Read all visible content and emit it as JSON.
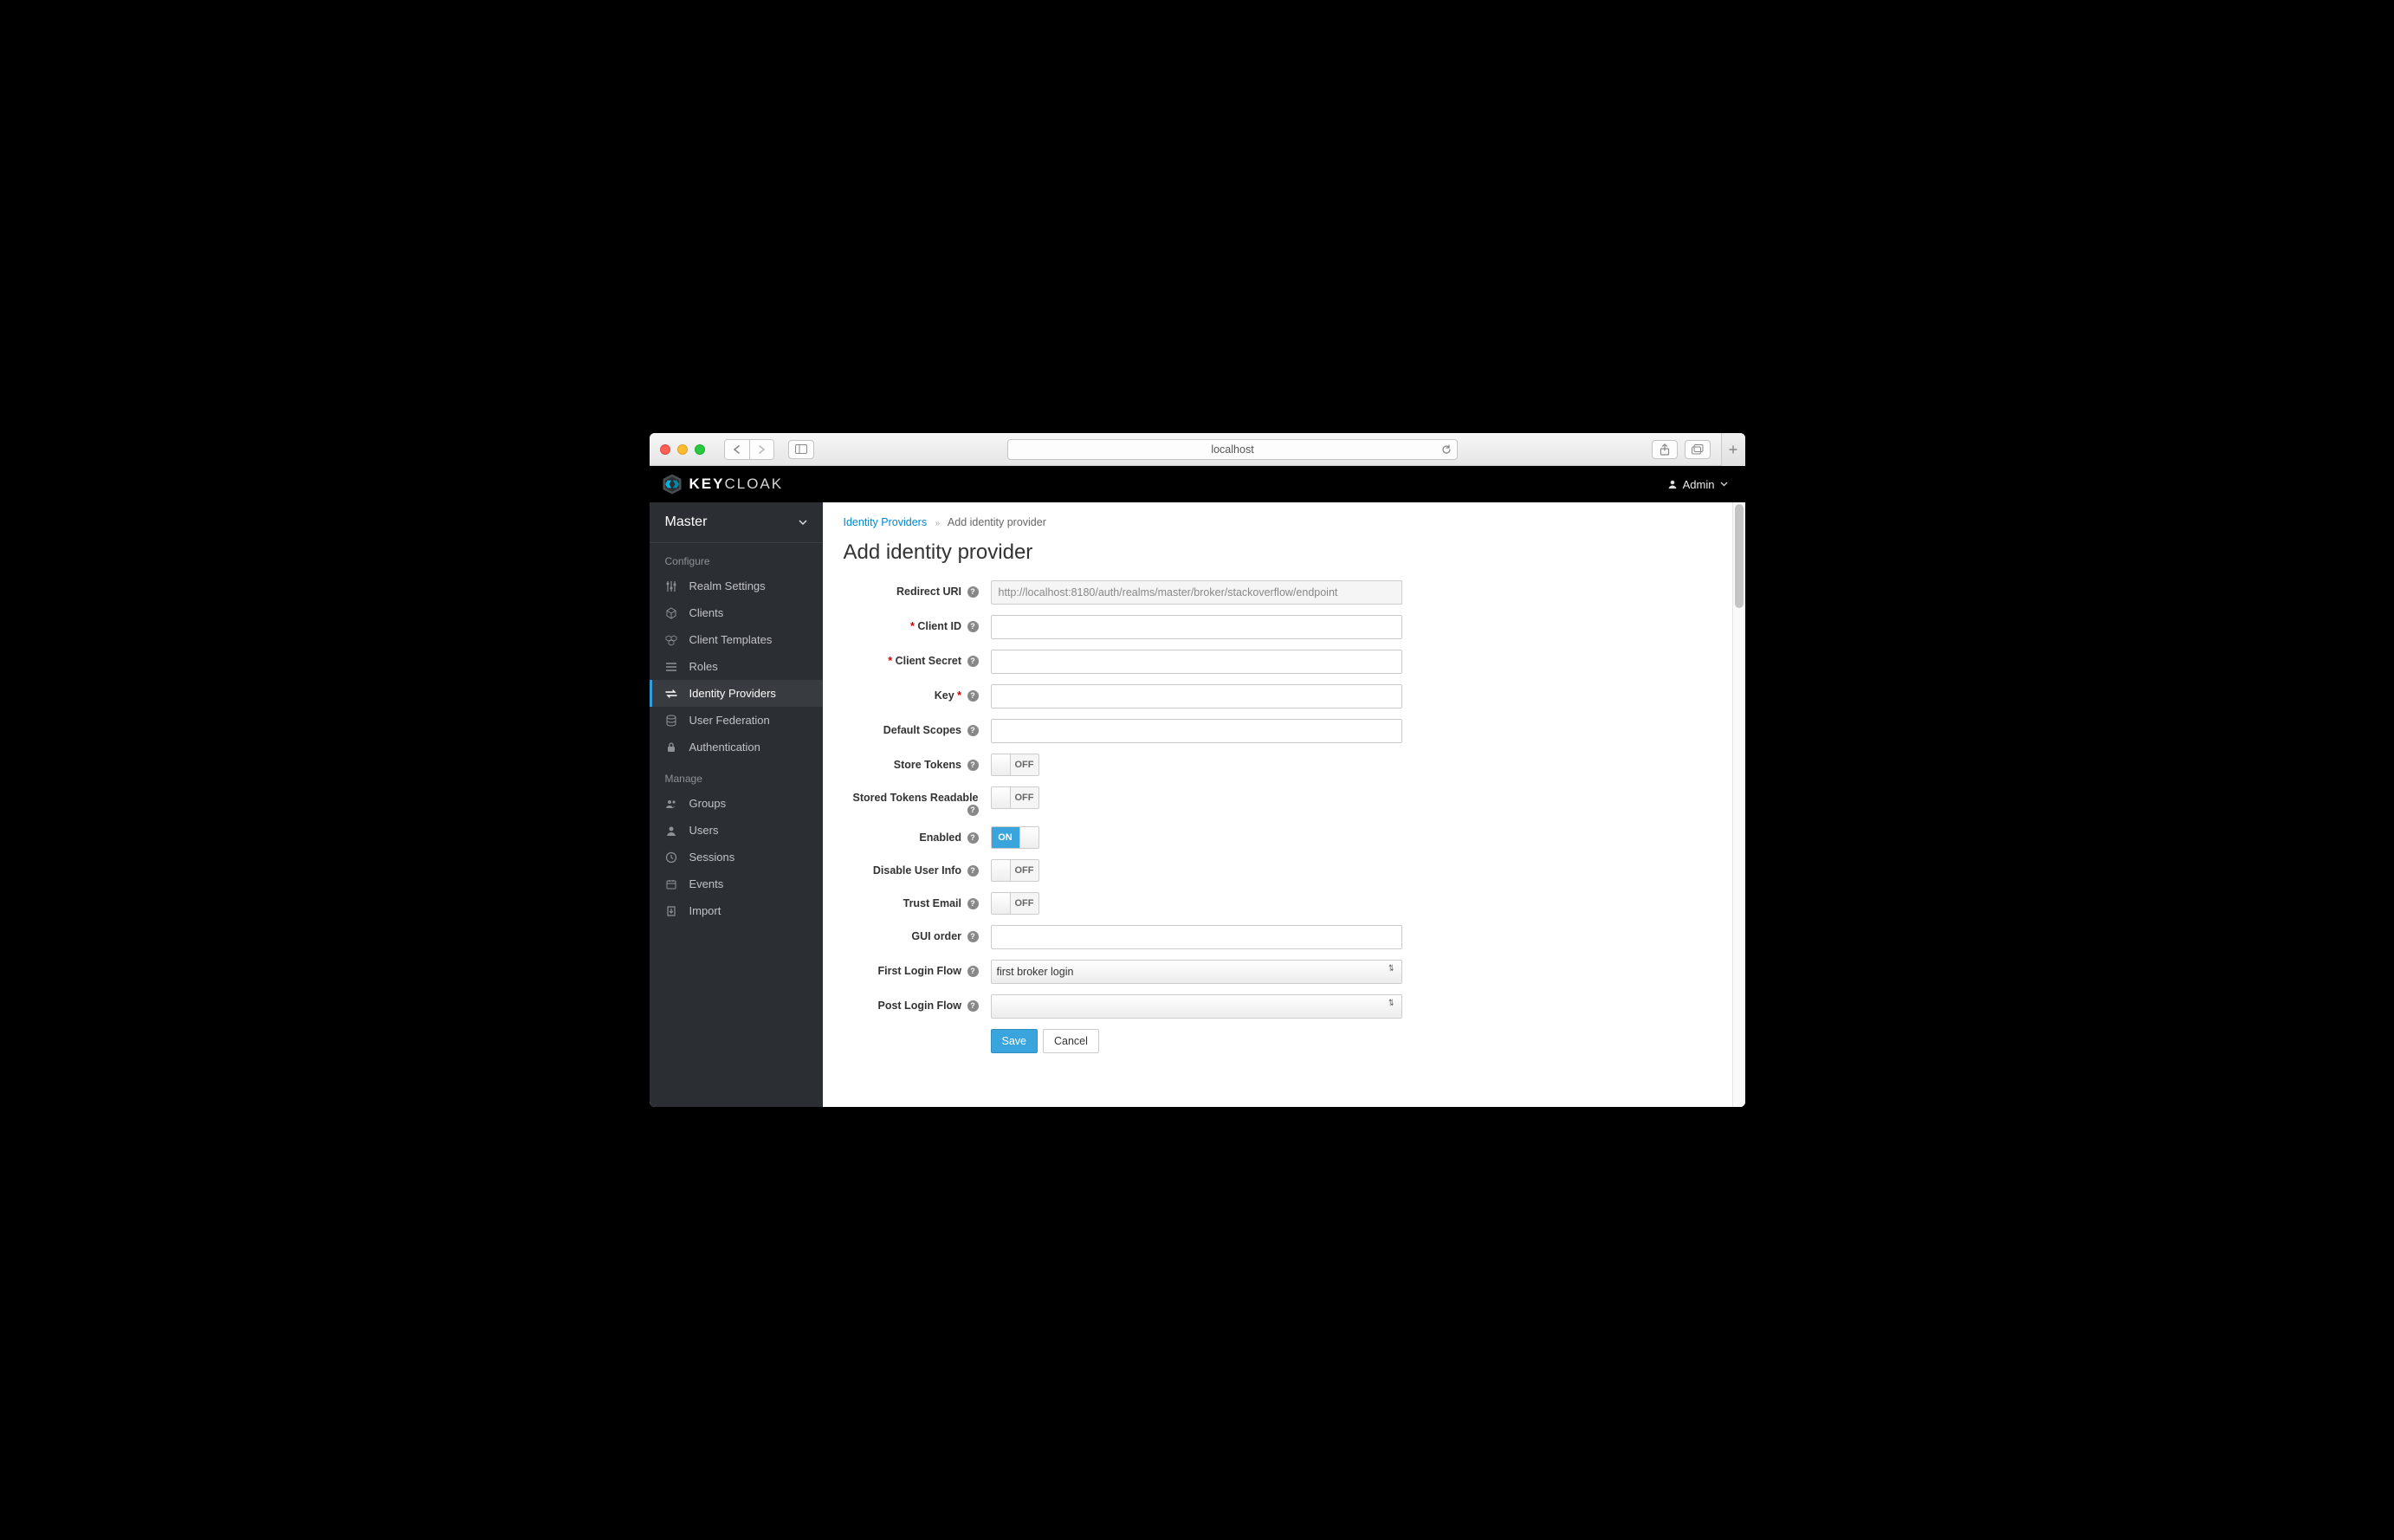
{
  "browser": {
    "host": "localhost"
  },
  "header": {
    "brand_a": "KEY",
    "brand_b": "CLOAK",
    "user": "Admin"
  },
  "realm": {
    "name": "Master"
  },
  "sections": {
    "configure": "Configure",
    "manage": "Manage"
  },
  "nav": {
    "realm_settings": "Realm Settings",
    "clients": "Clients",
    "client_templates": "Client Templates",
    "roles": "Roles",
    "identity_providers": "Identity Providers",
    "user_federation": "User Federation",
    "authentication": "Authentication",
    "groups": "Groups",
    "users": "Users",
    "sessions": "Sessions",
    "events": "Events",
    "import": "Import"
  },
  "breadcrumb": {
    "parent": "Identity Providers",
    "current": "Add identity provider"
  },
  "page_title": "Add identity provider",
  "labels": {
    "redirect_uri": "Redirect URI",
    "client_id": "Client ID",
    "client_secret": "Client Secret",
    "key": "Key",
    "default_scopes": "Default Scopes",
    "store_tokens": "Store Tokens",
    "stored_tokens_readable": "Stored Tokens Readable",
    "enabled": "Enabled",
    "disable_user_info": "Disable User Info",
    "trust_email": "Trust Email",
    "gui_order": "GUI order",
    "first_login_flow": "First Login Flow",
    "post_login_flow": "Post Login Flow"
  },
  "values": {
    "redirect_uri": "http://localhost:8180/auth/realms/master/broker/stackoverflow/endpoint",
    "client_id": "",
    "client_secret": "",
    "key": "",
    "default_scopes": "",
    "gui_order": "",
    "first_login_flow": "first broker login",
    "post_login_flow": ""
  },
  "toggles": {
    "store_tokens": "OFF",
    "stored_tokens_readable": "OFF",
    "enabled": "ON",
    "disable_user_info": "OFF",
    "trust_email": "OFF"
  },
  "buttons": {
    "save": "Save",
    "cancel": "Cancel"
  }
}
